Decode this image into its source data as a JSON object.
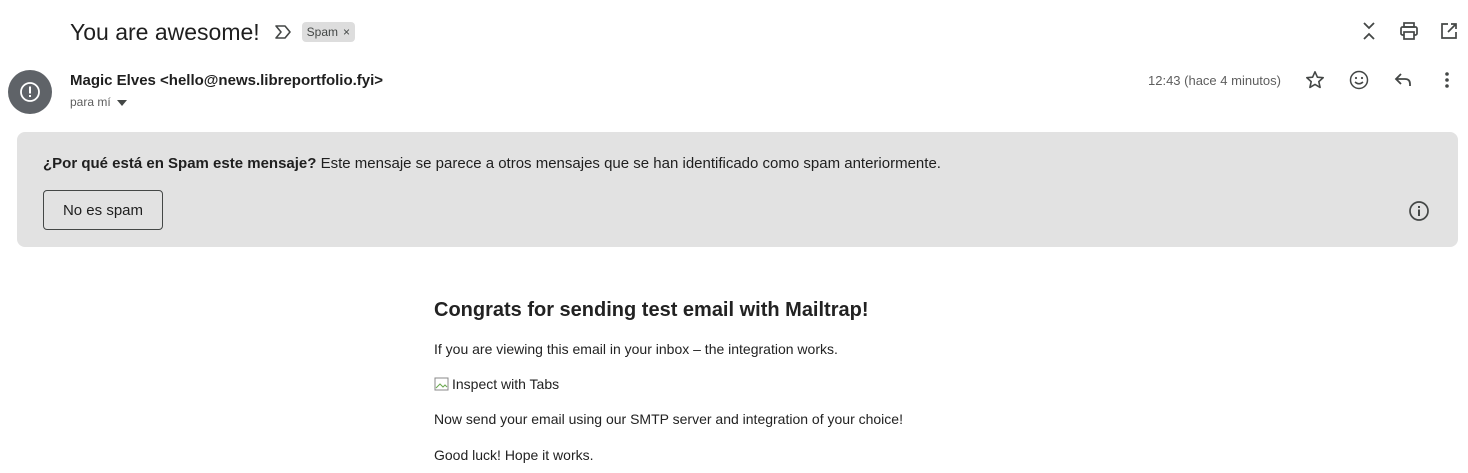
{
  "header": {
    "subject": "You are awesome!",
    "label": "Spam",
    "label_remove": "×"
  },
  "top_actions": [
    "collapse-icon",
    "print-icon",
    "open-in-new-window-icon"
  ],
  "message": {
    "sender": "Magic Elves <hello@news.libreportfolio.fyi>",
    "to": "para mí",
    "time": "12:43 (hace 4 minutos)",
    "actions": [
      "star-icon",
      "emoji-icon",
      "reply-icon",
      "more-vert-icon"
    ]
  },
  "spam_banner": {
    "title": "¿Por qué está en Spam este mensaje?",
    "explanation": "Este mensaje se parece a otros mensajes que se han identificado como spam anteriormente.",
    "not_spam_label": "No es spam"
  },
  "email_body": {
    "heading": "Congrats for sending test email with Mailtrap!",
    "p1": "If you are viewing this email in your inbox – the integration works.",
    "image_alt": "Inspect with Tabs",
    "p2": "Now send your email using our SMTP server and integration of your choice!",
    "p3": "Good luck! Hope it works."
  },
  "colors": {
    "banner_bg": "#e2e2e2",
    "avatar_bg": "#5f6368",
    "chip_bg": "#dddddd",
    "icon": "#444746"
  }
}
